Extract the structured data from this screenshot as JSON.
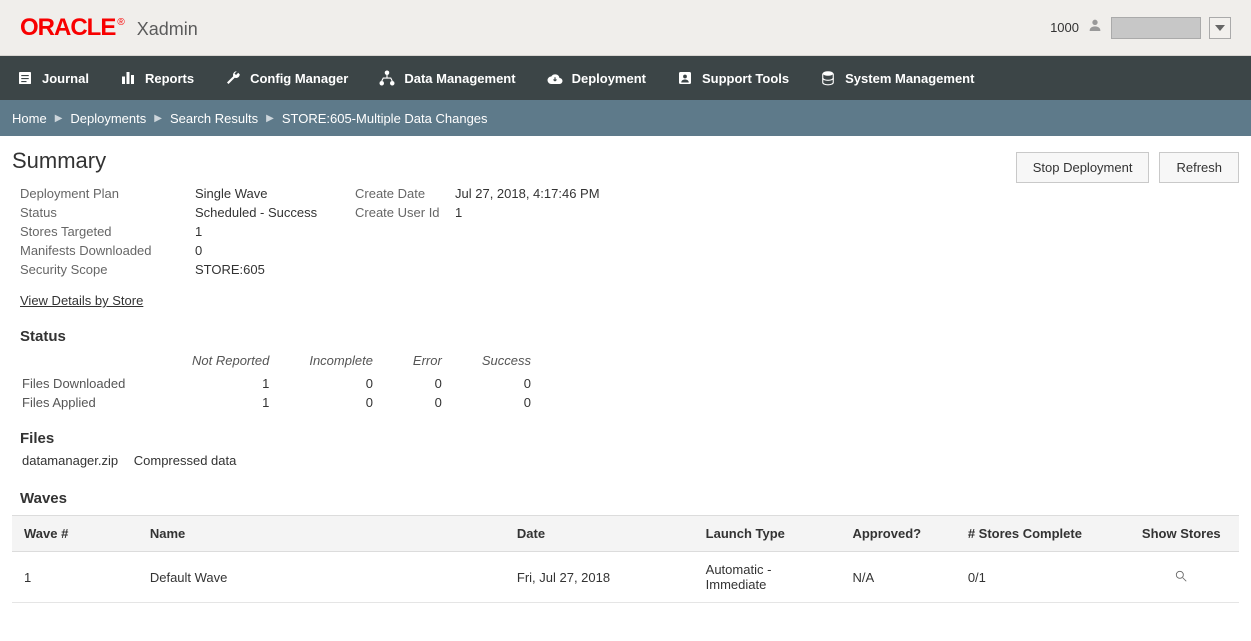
{
  "header": {
    "brand": "ORACLE",
    "app_name": "Xadmin",
    "user_number": "1000"
  },
  "nav": {
    "journal": "Journal",
    "reports": "Reports",
    "config_manager": "Config Manager",
    "data_management": "Data Management",
    "deployment": "Deployment",
    "support_tools": "Support Tools",
    "system_management": "System Management"
  },
  "breadcrumb": {
    "home": "Home",
    "deployments": "Deployments",
    "search_results": "Search Results",
    "current": "STORE:605-Multiple Data Changes"
  },
  "buttons": {
    "stop_deployment": "Stop Deployment",
    "refresh": "Refresh"
  },
  "summary": {
    "title": "Summary",
    "labels": {
      "deployment_plan": "Deployment Plan",
      "status": "Status",
      "stores_targeted": "Stores Targeted",
      "manifests_downloaded": "Manifests Downloaded",
      "security_scope": "Security Scope",
      "create_date": "Create Date",
      "create_user_id": "Create User Id"
    },
    "values": {
      "deployment_plan": "Single Wave",
      "status": "Scheduled - Success",
      "stores_targeted": "1",
      "manifests_downloaded": "0",
      "security_scope": "STORE:605",
      "create_date": "Jul 27, 2018, 4:17:46 PM",
      "create_user_id": "1"
    },
    "view_details": "View Details by Store"
  },
  "status_section": {
    "title": "Status",
    "headers": {
      "not_reported": "Not Reported",
      "incomplete": "Incomplete",
      "error": "Error",
      "success": "Success"
    },
    "rows": [
      {
        "label": "Files Downloaded",
        "not_reported": "1",
        "incomplete": "0",
        "error": "0",
        "success": "0"
      },
      {
        "label": "Files Applied",
        "not_reported": "1",
        "incomplete": "0",
        "error": "0",
        "success": "0"
      }
    ]
  },
  "files_section": {
    "title": "Files",
    "filename": "datamanager.zip",
    "desc": "Compressed data"
  },
  "waves_section": {
    "title": "Waves",
    "headers": {
      "wave_num": "Wave #",
      "name": "Name",
      "date": "Date",
      "launch_type": "Launch Type",
      "approved": "Approved?",
      "stores_complete": "# Stores Complete",
      "show_stores": "Show Stores"
    },
    "rows": [
      {
        "wave_num": "1",
        "name": "Default Wave",
        "date": "Fri, Jul 27, 2018",
        "launch_type": "Automatic - Immediate",
        "approved": "N/A",
        "stores_complete": "0/1"
      }
    ]
  }
}
